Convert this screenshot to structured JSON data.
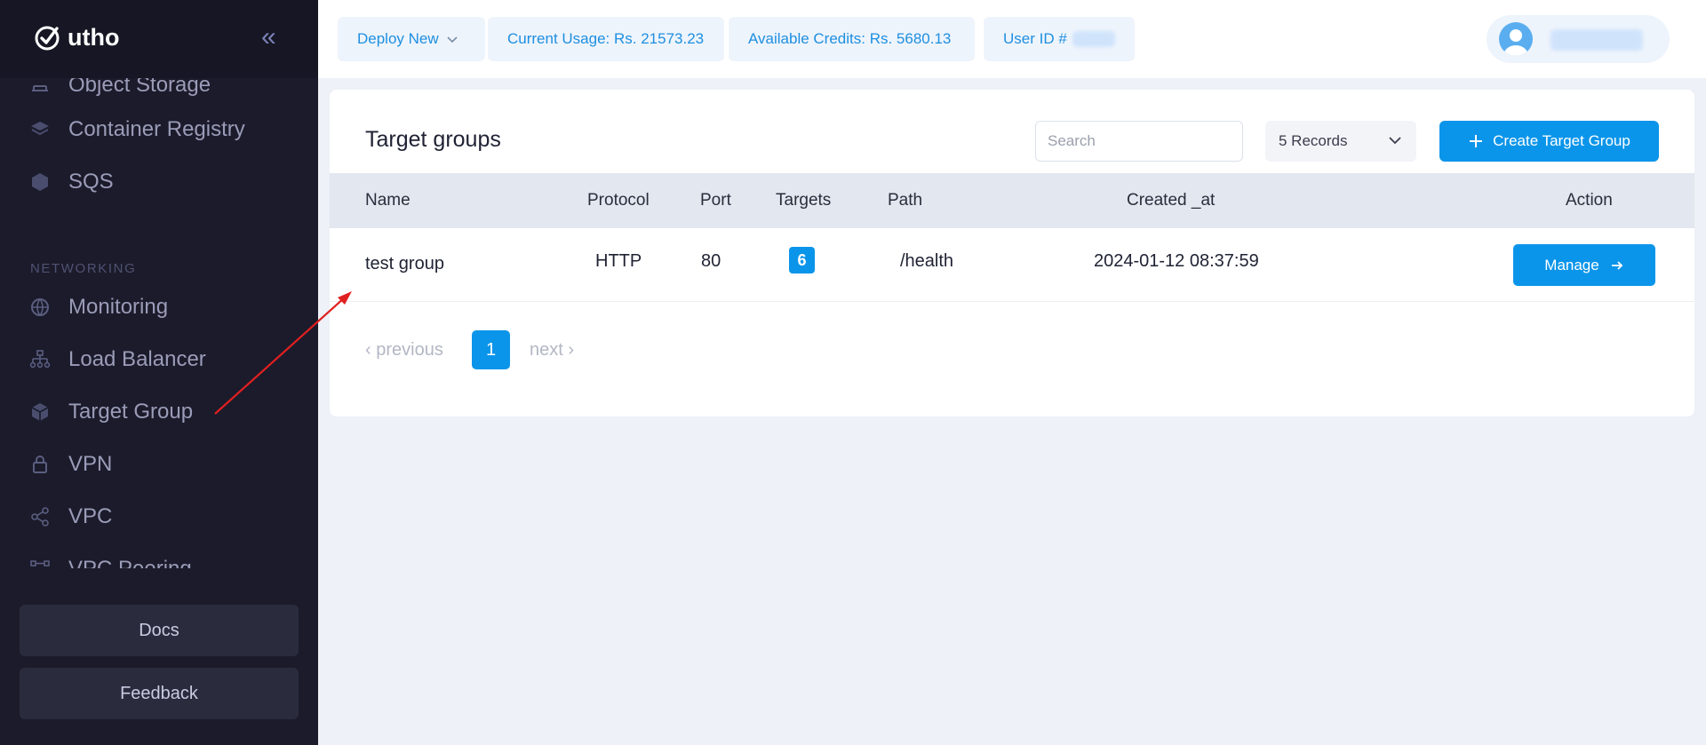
{
  "brand": {
    "name": "utho"
  },
  "sidebar": {
    "collapse_label": "«",
    "items_top": [
      {
        "label": "Object Storage",
        "icon": "storage-icon"
      },
      {
        "label": "Container Registry",
        "icon": "layers-icon"
      },
      {
        "label": "SQS",
        "icon": "hexagon-icon"
      }
    ],
    "section_label": "NETWORKING",
    "items_network": [
      {
        "label": "Monitoring",
        "icon": "globe-icon"
      },
      {
        "label": "Load Balancer",
        "icon": "network-tree-icon"
      },
      {
        "label": "Target Group",
        "icon": "cube-icon"
      },
      {
        "label": "VPN",
        "icon": "lock-icon"
      },
      {
        "label": "VPC",
        "icon": "share-icon"
      },
      {
        "label": "VPC Peering",
        "icon": "peering-icon"
      }
    ],
    "docs_label": "Docs",
    "feedback_label": "Feedback"
  },
  "topbar": {
    "deploy_label": "Deploy New",
    "usage_label": "Current Usage: Rs. 21573.23",
    "credits_label": "Available Credits: Rs. 5680.13",
    "user_id_label": "User ID #"
  },
  "main": {
    "title": "Target groups",
    "search_placeholder": "Search",
    "records_label": "5 Records",
    "create_label": "Create Target Group",
    "columns": [
      "Name",
      "Protocol",
      "Port",
      "Targets",
      "Path",
      "Created _at",
      "Action"
    ],
    "rows": [
      {
        "name": "test group",
        "protocol": "HTTP",
        "port": "80",
        "targets": "6",
        "path": "/health",
        "created_at": "2024-01-12 08:37:59",
        "action": "Manage"
      }
    ],
    "pagination": {
      "previous": "‹ previous",
      "page": "1",
      "next": "next ›"
    }
  },
  "colors": {
    "accent": "#0b95ea",
    "sidebar_bg": "#1b1b2b",
    "annotation_arrow": "#e02020"
  }
}
